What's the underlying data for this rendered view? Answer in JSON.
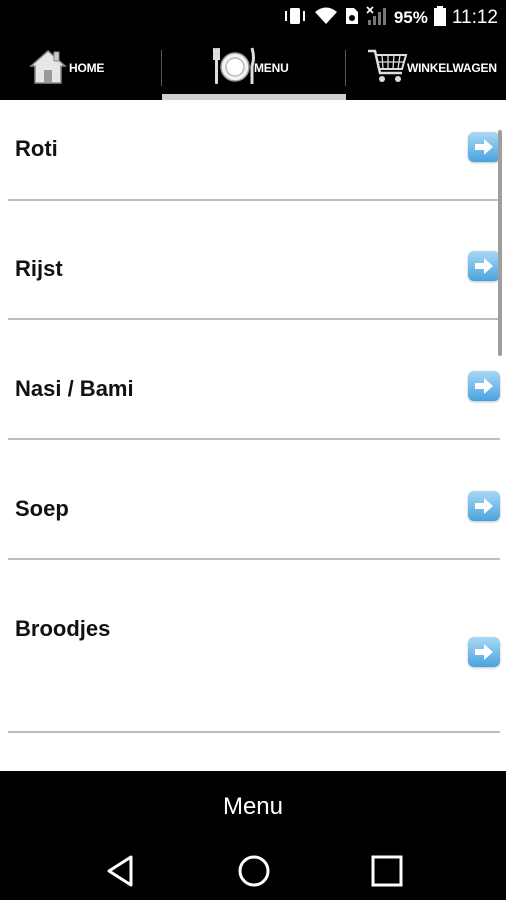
{
  "status_bar": {
    "battery_percent": "95%",
    "time": "11:12",
    "icons": [
      "vibrate-icon",
      "wifi-icon",
      "sim-icon",
      "signal-icon",
      "battery-icon"
    ]
  },
  "tabs": [
    {
      "label": "HOME",
      "icon": "house-icon"
    },
    {
      "label": "MENU",
      "icon": "plate-icon",
      "active": true
    },
    {
      "label": "WINKELWAGEN",
      "icon": "cart-icon"
    }
  ],
  "menu_items": [
    {
      "label": "Roti"
    },
    {
      "label": "Rijst"
    },
    {
      "label": "Nasi / Bami"
    },
    {
      "label": "Soep"
    },
    {
      "label": "Broodjes"
    }
  ],
  "bottom_title": "Menu",
  "nav_buttons": [
    "back-icon",
    "home-icon",
    "recents-icon"
  ],
  "colors": {
    "bar_background": "#000000",
    "content_background": "#ffffff",
    "arrow_button": "#4aa3de",
    "active_tab_indicator": "#cfcfcf"
  }
}
